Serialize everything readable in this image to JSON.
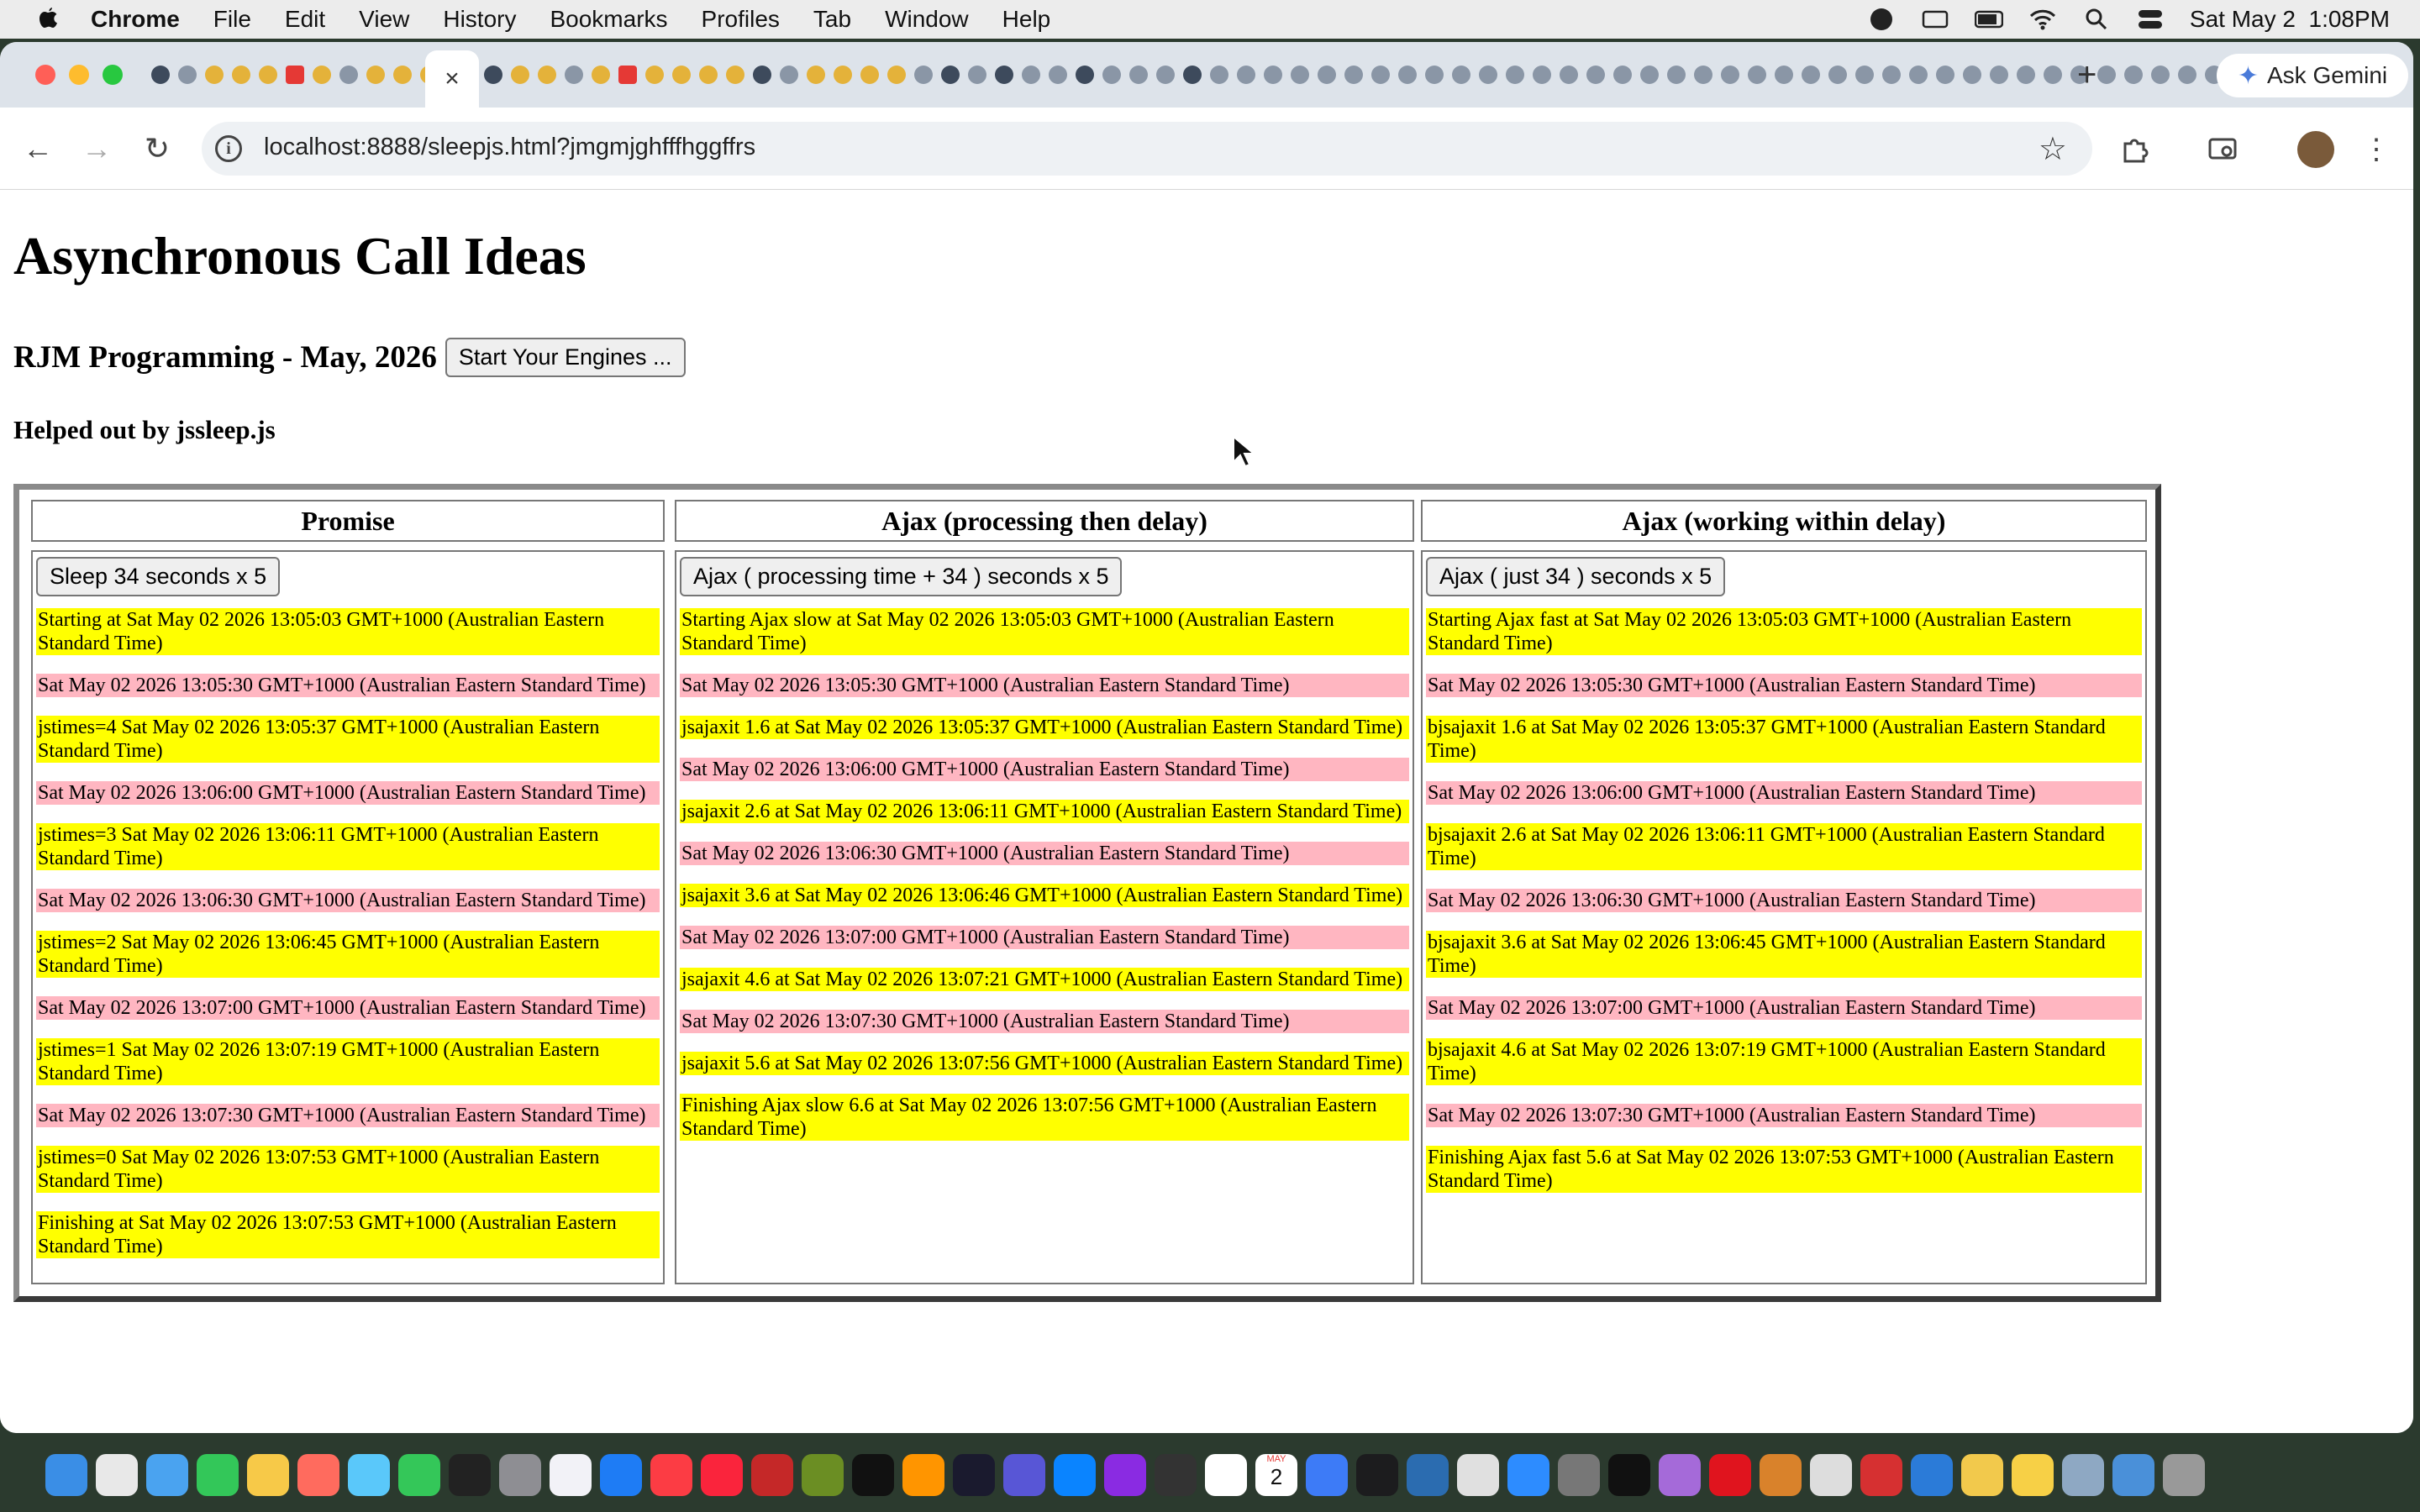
{
  "menubar": {
    "app_name": "Chrome",
    "items": [
      "File",
      "Edit",
      "View",
      "History",
      "Bookmarks",
      "Profiles",
      "Tab",
      "Window",
      "Help"
    ],
    "clock": "Sat May 2  1:08PM"
  },
  "browser": {
    "active_tab_close": "×",
    "new_tab": "+",
    "ask_gemini": "Ask Gemini",
    "url": "localhost:8888/sleepjs.html?jmgmjghfffhggffrs"
  },
  "page": {
    "title": "Asynchronous Call Ideas",
    "subtitle": "RJM Programming - May, 2026",
    "start_button": "Start Your Engines ...",
    "helper": "Helped out by jssleep.js",
    "columns": [
      {
        "heading": "Promise",
        "button": "Sleep 34 seconds x 5",
        "entries": [
          {
            "text": "Starting at Sat May 02 2026 13:05:03 GMT+1000 (Australian Eastern Standard Time)",
            "color": "#ffff00"
          },
          {
            "text": "Sat May 02 2026 13:05:30 GMT+1000 (Australian Eastern Standard Time)",
            "color": "#ffb6c1"
          },
          {
            "text": "jstimes=4 Sat May 02 2026 13:05:37 GMT+1000 (Australian Eastern Standard Time)",
            "color": "#ffff00"
          },
          {
            "text": "Sat May 02 2026 13:06:00 GMT+1000 (Australian Eastern Standard Time)",
            "color": "#ffb6c1"
          },
          {
            "text": "jstimes=3 Sat May 02 2026 13:06:11 GMT+1000 (Australian Eastern Standard Time)",
            "color": "#ffff00"
          },
          {
            "text": "Sat May 02 2026 13:06:30 GMT+1000 (Australian Eastern Standard Time)",
            "color": "#ffb6c1"
          },
          {
            "text": "jstimes=2 Sat May 02 2026 13:06:45 GMT+1000 (Australian Eastern Standard Time)",
            "color": "#ffff00"
          },
          {
            "text": "Sat May 02 2026 13:07:00 GMT+1000 (Australian Eastern Standard Time)",
            "color": "#ffb6c1"
          },
          {
            "text": "jstimes=1 Sat May 02 2026 13:07:19 GMT+1000 (Australian Eastern Standard Time)",
            "color": "#ffff00"
          },
          {
            "text": "Sat May 02 2026 13:07:30 GMT+1000 (Australian Eastern Standard Time)",
            "color": "#ffb6c1"
          },
          {
            "text": "jstimes=0 Sat May 02 2026 13:07:53 GMT+1000 (Australian Eastern Standard Time)",
            "color": "#ffff00"
          },
          {
            "text": "Finishing at Sat May 02 2026 13:07:53 GMT+1000 (Australian Eastern Standard Time)",
            "color": "#ffff00"
          }
        ]
      },
      {
        "heading": "Ajax (processing then delay)",
        "button": "Ajax ( processing time + 34 ) seconds x 5",
        "entries": [
          {
            "text": "Starting Ajax slow at Sat May 02 2026 13:05:03 GMT+1000 (Australian Eastern Standard Time)",
            "color": "#ffff00"
          },
          {
            "text": "Sat May 02 2026 13:05:30 GMT+1000 (Australian Eastern Standard Time)",
            "color": "#ffb6c1"
          },
          {
            "text": "jsajaxit 1.6 at Sat May 02 2026 13:05:37 GMT+1000 (Australian Eastern Standard Time)",
            "color": "#ffff00"
          },
          {
            "text": "Sat May 02 2026 13:06:00 GMT+1000 (Australian Eastern Standard Time)",
            "color": "#ffb6c1"
          },
          {
            "text": "jsajaxit 2.6 at Sat May 02 2026 13:06:11 GMT+1000 (Australian Eastern Standard Time)",
            "color": "#ffff00"
          },
          {
            "text": "Sat May 02 2026 13:06:30 GMT+1000 (Australian Eastern Standard Time)",
            "color": "#ffb6c1"
          },
          {
            "text": "jsajaxit 3.6 at Sat May 02 2026 13:06:46 GMT+1000 (Australian Eastern Standard Time)",
            "color": "#ffff00"
          },
          {
            "text": "Sat May 02 2026 13:07:00 GMT+1000 (Australian Eastern Standard Time)",
            "color": "#ffb6c1"
          },
          {
            "text": "jsajaxit 4.6 at Sat May 02 2026 13:07:21 GMT+1000 (Australian Eastern Standard Time)",
            "color": "#ffff00"
          },
          {
            "text": "Sat May 02 2026 13:07:30 GMT+1000 (Australian Eastern Standard Time)",
            "color": "#ffb6c1"
          },
          {
            "text": "jsajaxit 5.6 at Sat May 02 2026 13:07:56 GMT+1000 (Australian Eastern Standard Time)",
            "color": "#ffff00"
          },
          {
            "text": "Finishing Ajax slow 6.6 at Sat May 02 2026 13:07:56 GMT+1000 (Australian Eastern Standard Time)",
            "color": "#ffff00"
          }
        ]
      },
      {
        "heading": "Ajax (working within delay)",
        "button": "Ajax ( just 34 ) seconds x 5",
        "entries": [
          {
            "text": "Starting Ajax fast at Sat May 02 2026 13:05:03 GMT+1000 (Australian Eastern Standard Time)",
            "color": "#ffff00"
          },
          {
            "text": "Sat May 02 2026 13:05:30 GMT+1000 (Australian Eastern Standard Time)",
            "color": "#ffb6c1"
          },
          {
            "text": "bjsajaxit 1.6 at Sat May 02 2026 13:05:37 GMT+1000 (Australian Eastern Standard Time)",
            "color": "#ffff00"
          },
          {
            "text": "Sat May 02 2026 13:06:00 GMT+1000 (Australian Eastern Standard Time)",
            "color": "#ffb6c1"
          },
          {
            "text": "bjsajaxit 2.6 at Sat May 02 2026 13:06:11 GMT+1000 (Australian Eastern Standard Time)",
            "color": "#ffff00"
          },
          {
            "text": "Sat May 02 2026 13:06:30 GMT+1000 (Australian Eastern Standard Time)",
            "color": "#ffb6c1"
          },
          {
            "text": "bjsajaxit 3.6 at Sat May 02 2026 13:06:45 GMT+1000 (Australian Eastern Standard Time)",
            "color": "#ffff00"
          },
          {
            "text": "Sat May 02 2026 13:07:00 GMT+1000 (Australian Eastern Standard Time)",
            "color": "#ffb6c1"
          },
          {
            "text": "bjsajaxit 4.6 at Sat May 02 2026 13:07:19 GMT+1000 (Australian Eastern Standard Time)",
            "color": "#ffff00"
          },
          {
            "text": "Sat May 02 2026 13:07:30 GMT+1000 (Australian Eastern Standard Time)",
            "color": "#ffb6c1"
          },
          {
            "text": "Finishing Ajax fast 5.6 at Sat May 02 2026 13:07:53 GMT+1000 (Australian Eastern Standard Time)",
            "color": "#ffff00"
          }
        ]
      }
    ]
  },
  "dock": {
    "calendar_month": "MAY",
    "calendar_day": "2"
  }
}
